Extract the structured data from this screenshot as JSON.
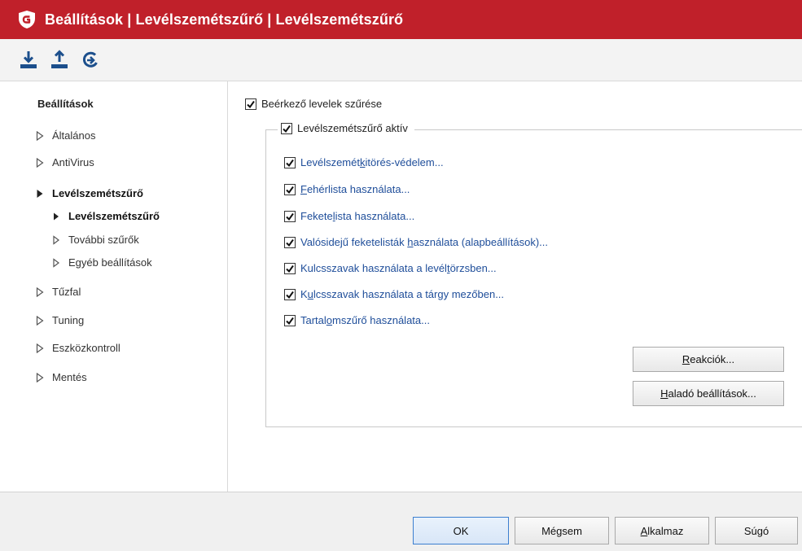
{
  "window": {
    "title": "Beállítások | Levélszemétszűrő | Levélszemétszűrő",
    "accent_color": "#c0202a",
    "logo_icon": "gdata-shield-icon"
  },
  "toolbar": {
    "buttons": [
      {
        "icon": "import-icon"
      },
      {
        "icon": "export-icon"
      },
      {
        "icon": "reset-icon"
      }
    ]
  },
  "sidebar": {
    "heading": "Beállítások",
    "items": [
      {
        "label": "Általános"
      },
      {
        "label": "AntiVirus"
      },
      {
        "label": "Levélszemétszűrő"
      },
      {
        "label": "Levélszemétszűrő"
      },
      {
        "label": "További szűrők"
      },
      {
        "label": "Egyéb beállítások"
      },
      {
        "label": "Tűzfal"
      },
      {
        "label": "Tuning"
      },
      {
        "label": "Eszközkontroll"
      },
      {
        "label": "Mentés"
      }
    ]
  },
  "main": {
    "incoming_filter": {
      "label": "Beérkező levelek szűrése",
      "checked": true
    },
    "spam_active": {
      "label": "Levélszemétszűrő aktív",
      "checked": true
    },
    "options": [
      {
        "pre": "Levélszemét",
        "ul": "k",
        "post": "itörés-védelem...",
        "checked": true
      },
      {
        "pre": "",
        "ul": "F",
        "post": "ehérlista használata...",
        "checked": true
      },
      {
        "pre": "Fekete",
        "ul": "l",
        "post": "ista használata...",
        "checked": true
      },
      {
        "pre": "Valósidejű feketelisták ",
        "ul": "h",
        "post": "asználata (alapbeállítások)...",
        "checked": true
      },
      {
        "pre": "Kulcsszavak használata a levél",
        "ul": "t",
        "post": "örzsben...",
        "checked": true
      },
      {
        "pre": "K",
        "ul": "u",
        "post": "lcsszavak használata a tárgy mezőben...",
        "checked": true
      },
      {
        "pre": "Tartal",
        "ul": "o",
        "post": "mszűrő használata...",
        "checked": true
      }
    ],
    "reactions_button": {
      "pre": "",
      "ul": "R",
      "post": "eakciók..."
    },
    "advanced_button": {
      "pre": "",
      "ul": "H",
      "post": "aladó beállítások..."
    }
  },
  "footer": {
    "ok_label": "OK",
    "cancel_label": "Mégsem",
    "apply": {
      "pre": "",
      "ul": "A",
      "post": "lkalmaz"
    },
    "help_label": "Súgó"
  }
}
